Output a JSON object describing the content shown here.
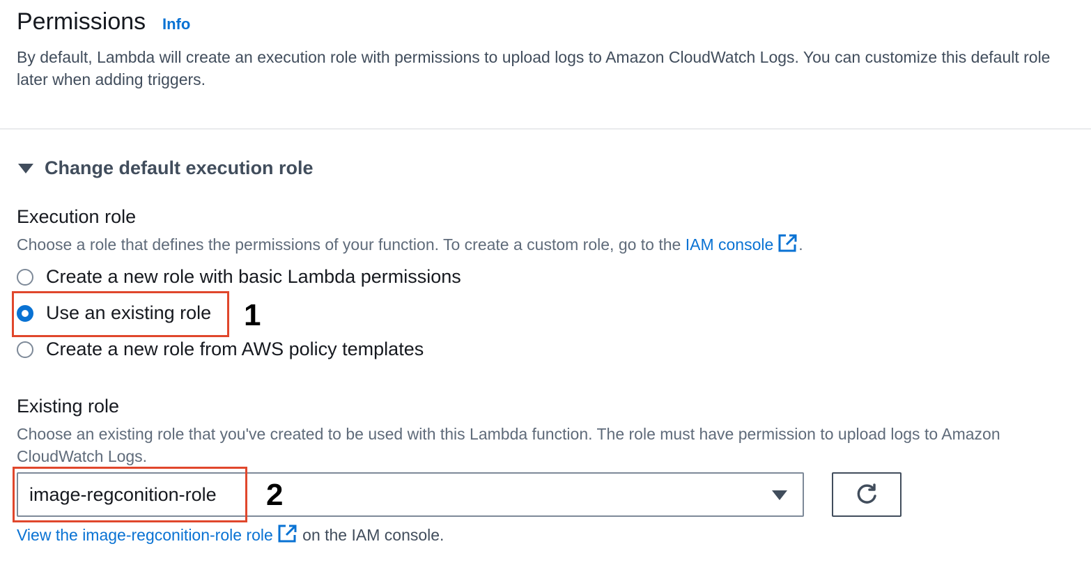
{
  "header": {
    "title": "Permissions",
    "info_label": "Info",
    "description": "By default, Lambda will create an execution role with permissions to upload logs to Amazon CloudWatch Logs. You can customize this default role later when adding triggers."
  },
  "expander": {
    "label": "Change default execution role",
    "expanded": true
  },
  "execution_role": {
    "label": "Execution role",
    "description_prefix": "Choose a role that defines the permissions of your function. To create a custom role, go to the ",
    "iam_link": "IAM console",
    "description_suffix": ".",
    "options": [
      {
        "label": "Create a new role with basic Lambda permissions",
        "selected": false
      },
      {
        "label": "Use an existing role",
        "selected": true
      },
      {
        "label": "Create a new role from AWS policy templates",
        "selected": false
      }
    ]
  },
  "existing_role": {
    "label": "Existing role",
    "description": "Choose an existing role that you've created to be used with this Lambda function. The role must have permission to upload logs to Amazon CloudWatch Logs.",
    "selected_value": "image-regconition-role",
    "view_link": "View the image-regconition-role role",
    "view_suffix": " on the IAM console."
  },
  "annotations": {
    "step1": "1",
    "step2": "2"
  },
  "colors": {
    "accent": "#0972d3",
    "highlight": "#e0472c",
    "text": "#16191f",
    "secondary_text": "#5f6b7a"
  },
  "icons": {
    "external_link": "external-link-icon",
    "refresh": "refresh-icon",
    "caret": "caret-down-icon"
  }
}
